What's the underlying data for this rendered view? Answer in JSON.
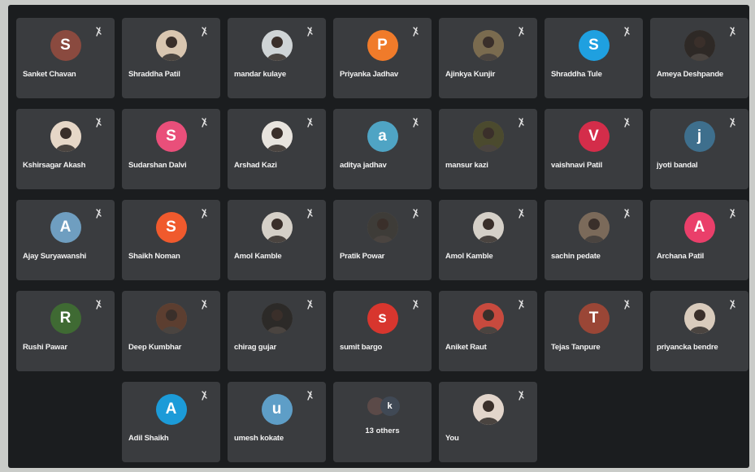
{
  "meeting": {
    "participants": [
      {
        "name": "Sanket Chavan",
        "avatar": "S",
        "color": "#8a4a3f",
        "photo": false
      },
      {
        "name": "Shraddha Patil",
        "avatar": "",
        "color": "#d9c6b0",
        "photo": true
      },
      {
        "name": "mandar kulaye",
        "avatar": "",
        "color": "#cfd4d6",
        "photo": true
      },
      {
        "name": "Priyanka Jadhav",
        "avatar": "P",
        "color": "#f07b2a",
        "photo": false
      },
      {
        "name": "Ajinkya Kunjir",
        "avatar": "",
        "color": "#7a6b4f",
        "photo": true
      },
      {
        "name": "Shraddha Tule",
        "avatar": "S",
        "color": "#1fa0e0",
        "photo": false
      },
      {
        "name": "Ameya Deshpande",
        "avatar": "",
        "color": "#2e2926",
        "photo": true
      },
      {
        "name": "Kshirsagar Akash",
        "avatar": "",
        "color": "#e6d7c7",
        "photo": true
      },
      {
        "name": "Sudarshan Dalvi",
        "avatar": "S",
        "color": "#e94f7a",
        "photo": false
      },
      {
        "name": "Arshad Kazi",
        "avatar": "",
        "color": "#e8e4de",
        "photo": true
      },
      {
        "name": "aditya jadhav",
        "avatar": "a",
        "color": "#4fa4c4",
        "photo": false
      },
      {
        "name": "mansur kazi",
        "avatar": "",
        "color": "#4b4a2e",
        "photo": true
      },
      {
        "name": "vaishnavi Patil",
        "avatar": "V",
        "color": "#d42d4a",
        "photo": false
      },
      {
        "name": "jyoti bandal",
        "avatar": "j",
        "color": "#3e6f8d",
        "photo": false
      },
      {
        "name": "Ajay Suryawanshi",
        "avatar": "A",
        "color": "#6f9ec0",
        "photo": false
      },
      {
        "name": "Shaikh Noman",
        "avatar": "S",
        "color": "#f05a2d",
        "photo": false
      },
      {
        "name": "Amol Kamble",
        "avatar": "",
        "color": "#d5d0c8",
        "photo": true
      },
      {
        "name": "Pratik Powar",
        "avatar": "",
        "color": "#3e3c38",
        "photo": true
      },
      {
        "name": "Amol Kamble",
        "avatar": "",
        "color": "#d5d0c8",
        "photo": true
      },
      {
        "name": "sachin pedate",
        "avatar": "",
        "color": "#7b6a5a",
        "photo": true
      },
      {
        "name": "Archana Patil",
        "avatar": "A",
        "color": "#ea3f6a",
        "photo": false
      },
      {
        "name": "Rushi Pawar",
        "avatar": "R",
        "color": "#3f6a33",
        "photo": false
      },
      {
        "name": "Deep Kumbhar",
        "avatar": "",
        "color": "#5c3e30",
        "photo": true
      },
      {
        "name": "chirag gujar",
        "avatar": "",
        "color": "#2c2a28",
        "photo": true
      },
      {
        "name": "sumit bargo",
        "avatar": "s",
        "color": "#d8362e",
        "photo": false
      },
      {
        "name": "Aniket Raut",
        "avatar": "",
        "color": "#c84a3e",
        "photo": true
      },
      {
        "name": "Tejas Tanpure",
        "avatar": "T",
        "color": "#9a4636",
        "photo": false
      },
      {
        "name": "priyancka bendre",
        "avatar": "",
        "color": "#d9cbbc",
        "photo": true
      },
      {
        "empty": true
      },
      {
        "name": "Adil Shaikh",
        "avatar": "A",
        "color": "#1c9bd8",
        "photo": false
      },
      {
        "name": "umesh kokate",
        "avatar": "u",
        "color": "#5e9ec7",
        "photo": false
      },
      {
        "others": true,
        "label": "13 others",
        "avatar": "k"
      },
      {
        "name": "You",
        "avatar": "",
        "color": "#e2d5cb",
        "photo": true
      }
    ]
  }
}
